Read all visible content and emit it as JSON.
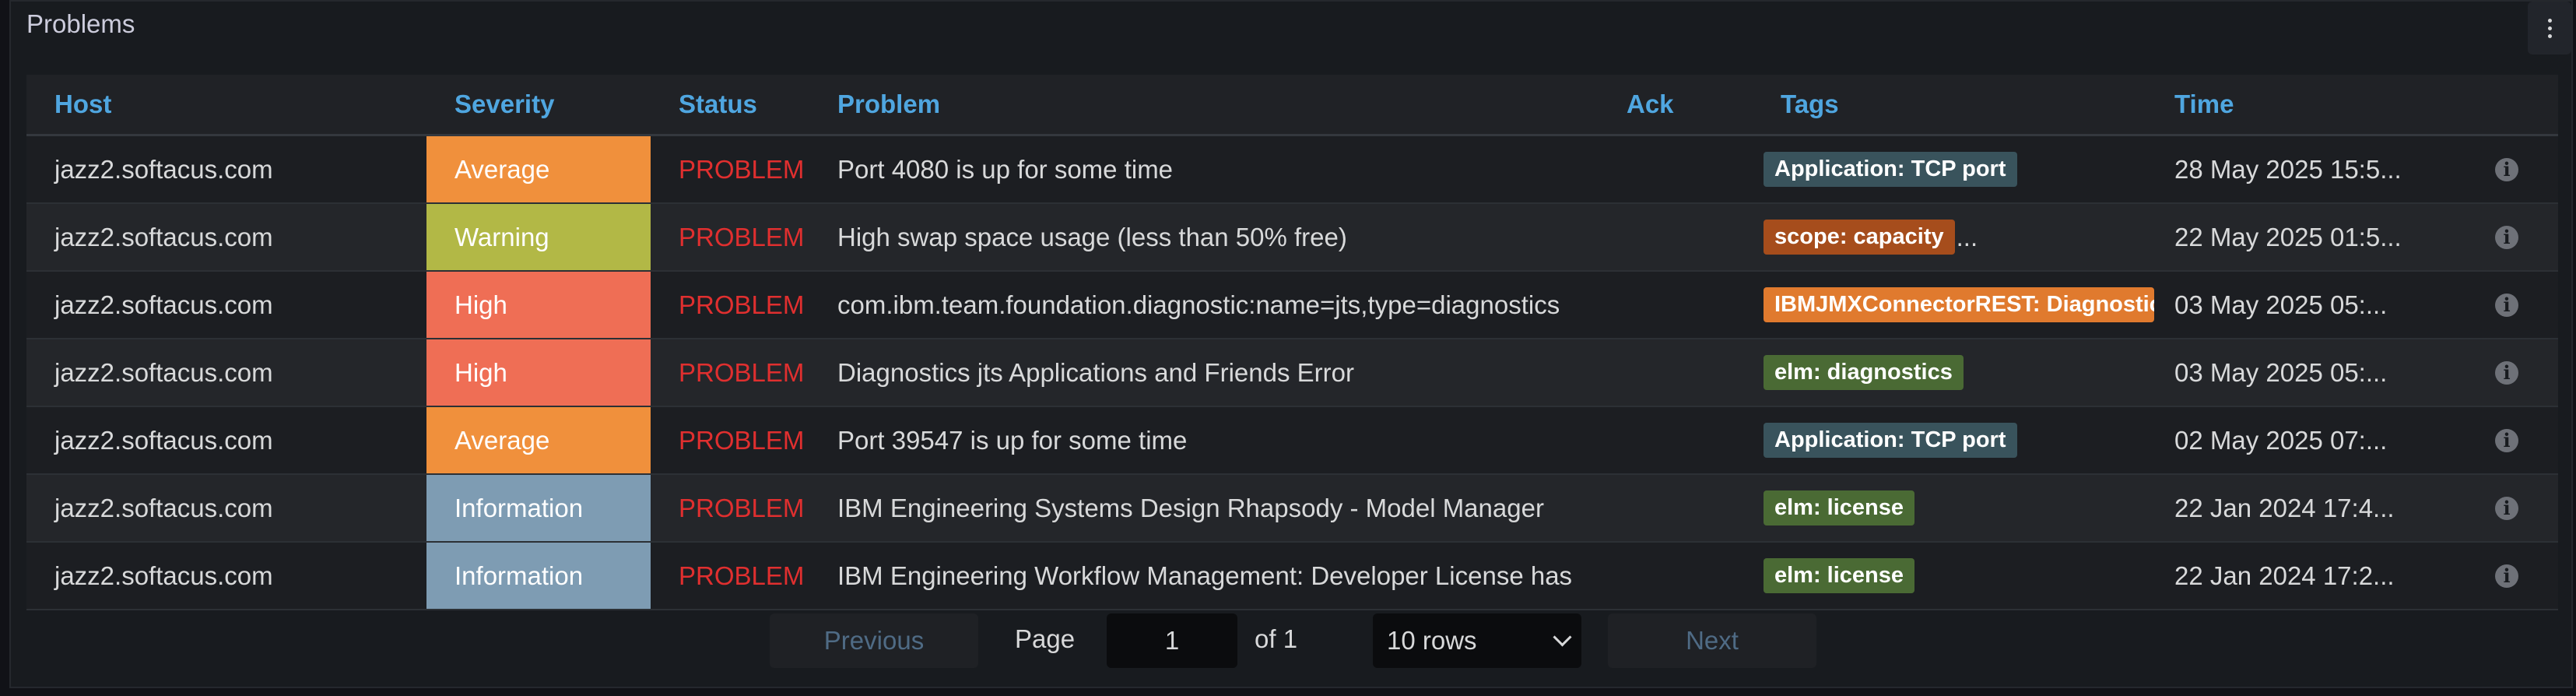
{
  "panel": {
    "title": "Problems"
  },
  "columns": {
    "host": "Host",
    "severity": "Severity",
    "status": "Status",
    "problem": "Problem",
    "ack": "Ack",
    "tags": "Tags",
    "time": "Time"
  },
  "rows": [
    {
      "host": "jazz2.softacus.com",
      "severity": "Average",
      "sev_color": "#f0903c",
      "status": "PROBLEM",
      "problem": "Port 4080 is up for some time",
      "tag": "Application: TCP port",
      "tag_color": "#39535c",
      "tag_ellipsis": "",
      "time": "28 May 2025 15:5..."
    },
    {
      "host": "jazz2.softacus.com",
      "severity": "Warning",
      "sev_color": "#b2b846",
      "status": "PROBLEM",
      "problem": "High swap space usage (less than 50% free)",
      "tag": "scope: capacity",
      "tag_color": "#a64d1c",
      "tag_ellipsis": "...",
      "time": "22 May 2025 01:5..."
    },
    {
      "host": "jazz2.softacus.com",
      "severity": "High",
      "sev_color": "#ef6e55",
      "status": "PROBLEM",
      "problem": "com.ibm.team.foundation.diagnostic:name=jts,type=diagnostics",
      "tag": "IBMJMXConnectorREST: Diagnostics",
      "tag_color": "#e07a2e",
      "tag_ellipsis": "",
      "time": "03 May 2025 05:..."
    },
    {
      "host": "jazz2.softacus.com",
      "severity": "High",
      "sev_color": "#ef6e55",
      "status": "PROBLEM",
      "problem": "Diagnostics jts Applications and Friends Error",
      "tag": "elm: diagnostics",
      "tag_color": "#4a6a34",
      "tag_ellipsis": "",
      "time": "03 May 2025 05:..."
    },
    {
      "host": "jazz2.softacus.com",
      "severity": "Average",
      "sev_color": "#f0903c",
      "status": "PROBLEM",
      "problem": "Port 39547 is up for some time",
      "tag": "Application: TCP port",
      "tag_color": "#39535c",
      "tag_ellipsis": "",
      "time": "02 May 2025 07:..."
    },
    {
      "host": "jazz2.softacus.com",
      "severity": "Information",
      "sev_color": "#7e9cb3",
      "status": "PROBLEM",
      "problem": "IBM Engineering Systems Design Rhapsody - Model Manager",
      "tag": "elm: license",
      "tag_color": "#4a6a34",
      "tag_ellipsis": "",
      "time": "22 Jan 2024 17:4..."
    },
    {
      "host": "jazz2.softacus.com",
      "severity": "Information",
      "sev_color": "#7e9cb3",
      "status": "PROBLEM",
      "problem": "IBM Engineering Workflow Management: Developer License has",
      "tag": "elm: license",
      "tag_color": "#4a6a34",
      "tag_ellipsis": "",
      "time": "22 Jan 2024 17:2..."
    }
  ],
  "pagination": {
    "previous": "Previous",
    "page_label": "Page",
    "page_value": "1",
    "of_label": "of 1",
    "rows_select": "10 rows",
    "next": "Next"
  },
  "icons": {
    "info": "info-icon",
    "menu": "vertical-dots-icon",
    "select": "chevron-down-icon"
  }
}
